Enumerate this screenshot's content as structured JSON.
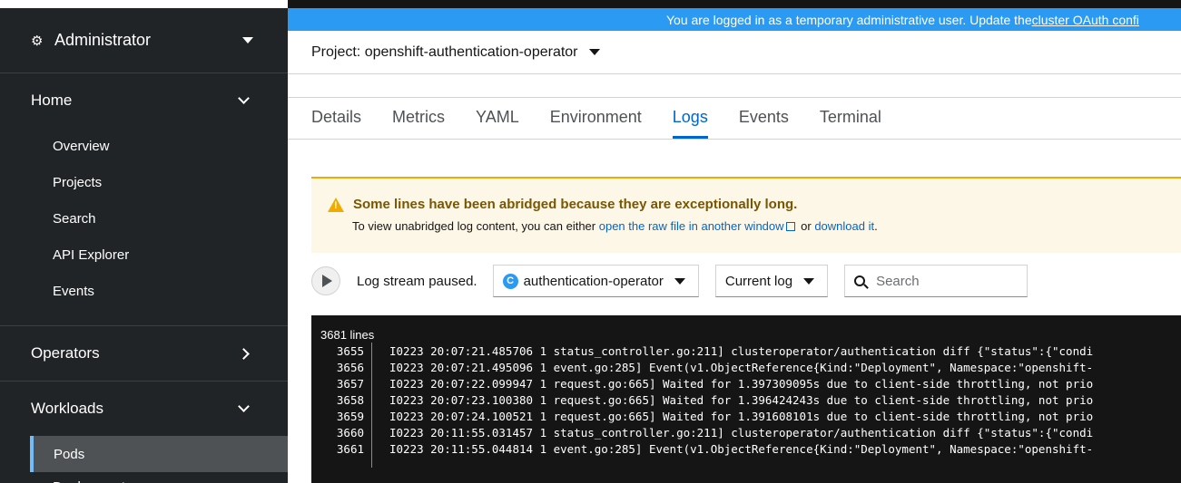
{
  "sidebar": {
    "perspective": "Administrator",
    "sections": {
      "home": {
        "label": "Home",
        "items": [
          "Overview",
          "Projects",
          "Search",
          "API Explorer",
          "Events"
        ]
      },
      "operators": {
        "label": "Operators"
      },
      "workloads": {
        "label": "Workloads",
        "items": [
          "Pods",
          "Deployments"
        ]
      }
    }
  },
  "banner": {
    "text": "You are logged in as a temporary administrative user. Update the ",
    "link": "cluster OAuth confi"
  },
  "project": {
    "label": "Project: openshift-authentication-operator"
  },
  "tabs": [
    "Details",
    "Metrics",
    "YAML",
    "Environment",
    "Logs",
    "Events",
    "Terminal"
  ],
  "active_tab": "Logs",
  "alert": {
    "title": "Some lines have been abridged because they are exceptionally long.",
    "text_before": "To view unabridged log content, you can either ",
    "link1": "open the raw file in another window",
    "text_middle": " or ",
    "link2": "download it",
    "text_after": "."
  },
  "toolbar": {
    "status": "Log stream paused.",
    "container_badge": "C",
    "container": "authentication-operator",
    "log_select": "Current log",
    "search_placeholder": "Search"
  },
  "log": {
    "line_count": "3681 lines",
    "lines": [
      {
        "num": "3655",
        "text": "I0223 20:07:21.485706 1 status_controller.go:211] clusteroperator/authentication diff {\"status\":{\"condi"
      },
      {
        "num": "3656",
        "text": "I0223 20:07:21.495096 1 event.go:285] Event(v1.ObjectReference{Kind:\"Deployment\", Namespace:\"openshift-"
      },
      {
        "num": "3657",
        "text": "I0223 20:07:22.099947 1 request.go:665] Waited for 1.397309095s due to client-side throttling, not prio"
      },
      {
        "num": "3658",
        "text": "I0223 20:07:23.100380 1 request.go:665] Waited for 1.396424243s due to client-side throttling, not prio"
      },
      {
        "num": "3659",
        "text": "I0223 20:07:24.100521 1 request.go:665] Waited for 1.391608101s due to client-side throttling, not prio"
      },
      {
        "num": "3660",
        "text": "I0223 20:11:55.031457 1 status_controller.go:211] clusteroperator/authentication diff {\"status\":{\"condi"
      },
      {
        "num": "3661",
        "text": "I0223 20:11:55.044814 1 event.go:285] Event(v1.ObjectReference{Kind:\"Deployment\", Namespace:\"openshift-"
      }
    ]
  },
  "colors": {
    "sidebar_bg": "#212427",
    "banner_bg": "#2b9af3",
    "accent": "#0066cc",
    "warning": "#f0ab00",
    "log_bg": "#151515"
  }
}
